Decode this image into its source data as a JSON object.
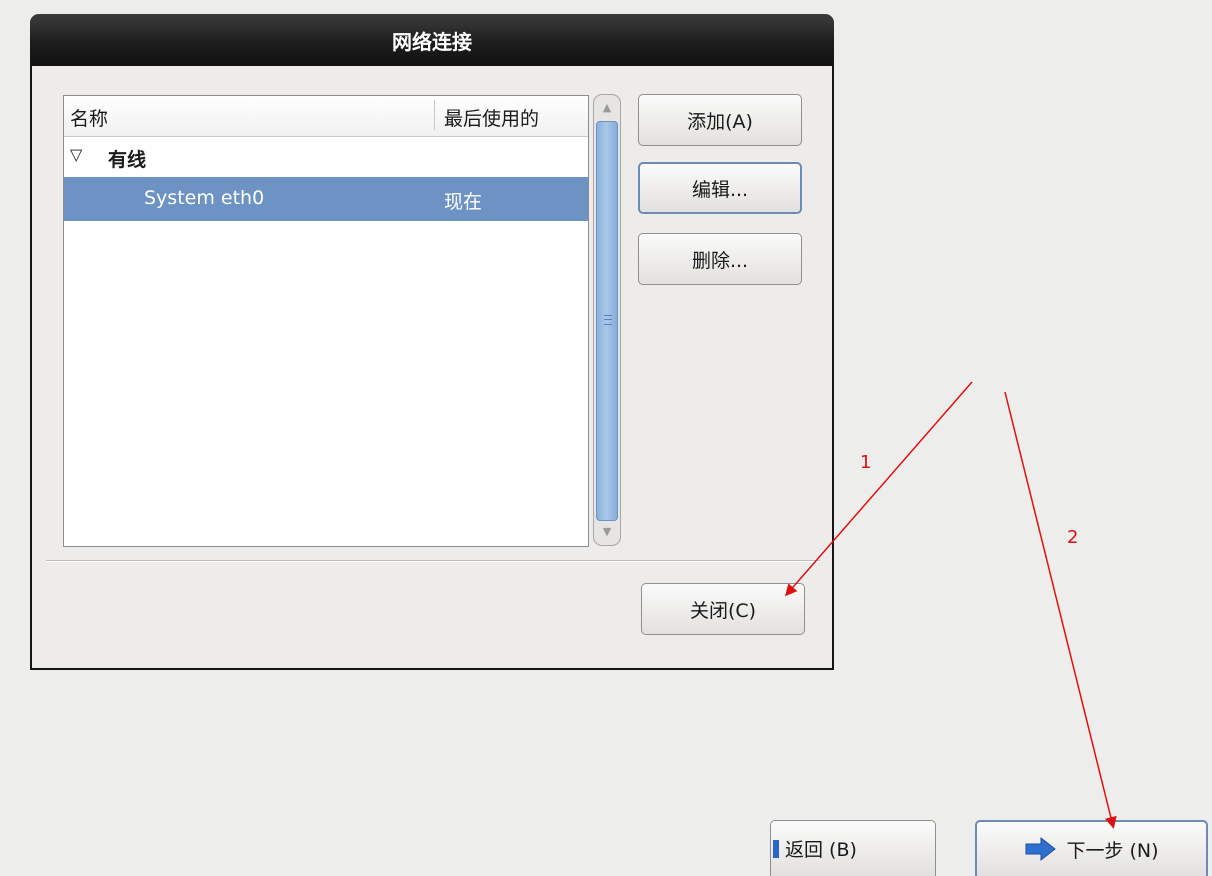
{
  "dialog": {
    "title": "网络连接",
    "list": {
      "columns": [
        "名称",
        "最后使用的"
      ],
      "group": {
        "toggle": "▽",
        "label": "有线"
      },
      "rows": [
        {
          "name": "System eth0",
          "last_used": "现在"
        }
      ]
    },
    "buttons": {
      "add": "添加(A)",
      "edit": "编辑...",
      "delete": "删除...",
      "close": "关闭(C)"
    }
  },
  "wizard": {
    "back": "返回 (B)",
    "next": "下一步 (N)"
  },
  "annotations": {
    "labels": [
      "1",
      "2"
    ],
    "color": "#e01010"
  }
}
